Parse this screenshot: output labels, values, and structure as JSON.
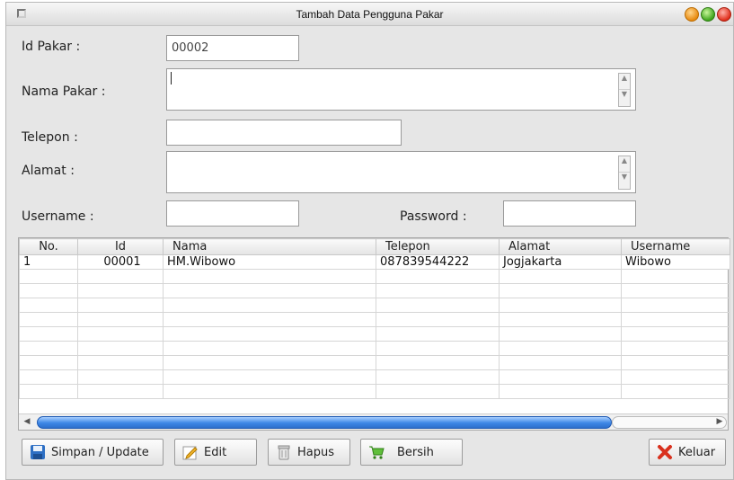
{
  "window": {
    "title": "Tambah Data Pengguna Pakar"
  },
  "form": {
    "id_pakar": {
      "label": "Id Pakar :",
      "value": "00002"
    },
    "nama_pakar": {
      "label": "Nama Pakar :",
      "value": ""
    },
    "telepon": {
      "label": "Telepon :",
      "value": ""
    },
    "alamat": {
      "label": "Alamat :",
      "value": ""
    },
    "username": {
      "label": "Username :",
      "value": ""
    },
    "password": {
      "label": "Password :",
      "value": ""
    }
  },
  "table": {
    "columns": [
      "No.",
      "Id",
      "Nama",
      "Telepon",
      "Alamat",
      "Username"
    ],
    "rows": [
      [
        "1",
        "00001",
        "HM.Wibowo",
        "087839544222",
        "Jogjakarta",
        "Wibowo"
      ]
    ]
  },
  "buttons": {
    "simpan": "Simpan / Update",
    "edit": "Edit",
    "hapus": "Hapus",
    "bersih": "Bersih",
    "keluar": "Keluar"
  },
  "icons": {
    "simpan": "floppy-disk-icon",
    "edit": "pencil-icon",
    "hapus": "trash-icon",
    "bersih": "cart-icon",
    "keluar": "x-icon"
  }
}
